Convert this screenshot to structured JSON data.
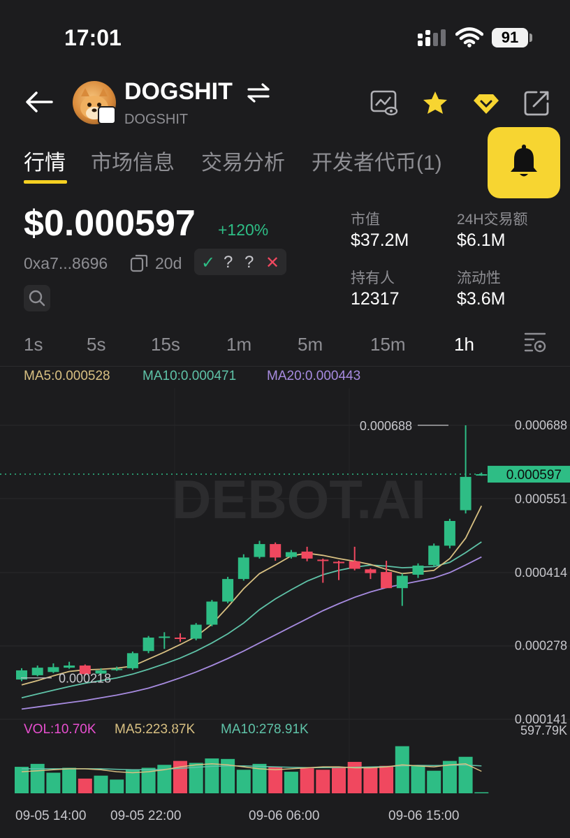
{
  "status_bar": {
    "time": "17:01",
    "battery": "91"
  },
  "header": {
    "token_name": "DOGSHIT",
    "token_symbol": "DOGSHIT",
    "icons": [
      "back-arrow-icon",
      "swap-icon",
      "watch-chart-icon",
      "star-icon",
      "diamond-icon",
      "share-icon",
      "bell-icon"
    ],
    "accent": "#f7d531"
  },
  "tabs": [
    {
      "label": "行情",
      "active": true
    },
    {
      "label": "市场信息",
      "active": false
    },
    {
      "label": "交易分析",
      "active": false
    },
    {
      "label": "开发者代币(1)",
      "active": false
    }
  ],
  "summary": {
    "price": "$0.000597",
    "change": "+120%",
    "address": "0xa7...8696",
    "age": "20d",
    "checks": [
      "✓",
      "?",
      "?",
      "✕"
    ],
    "stats": [
      {
        "label": "市值",
        "value": "$37.2M"
      },
      {
        "label": "24H交易额",
        "value": "$6.1M"
      },
      {
        "label": "持有人",
        "value": "12317"
      },
      {
        "label": "流动性",
        "value": "$3.6M"
      }
    ]
  },
  "timeframes": [
    {
      "label": "1s",
      "active": false
    },
    {
      "label": "5s",
      "active": false
    },
    {
      "label": "15s",
      "active": false
    },
    {
      "label": "1m",
      "active": false
    },
    {
      "label": "5m",
      "active": false
    },
    {
      "label": "15m",
      "active": false
    },
    {
      "label": "1h",
      "active": true
    }
  ],
  "legend": {
    "ma5": "MA5:0.000528",
    "ma10": "MA10:0.000471",
    "ma20": "MA20:0.000443",
    "vol": "VOL:10.70K",
    "vol_ma5": "MA5:223.87K",
    "vol_ma10": "MA10:278.91K"
  },
  "colors": {
    "up": "#2ebd85",
    "down": "#f0485f",
    "ma5": "#d8c082",
    "ma10": "#5fc3a8",
    "ma20": "#a78be0",
    "vol_label": "#e84fd0"
  },
  "watermark": "DEBOT.AI",
  "chart_data": {
    "type": "candlestick",
    "interval": "1h",
    "y_ticks": [
      "0.000688",
      "0.000551",
      "0.000414",
      "0.000278",
      "0.000141"
    ],
    "ylim": [
      0.000141,
      0.000688
    ],
    "current_price_label": "0.000597",
    "high_marker": "0.000688",
    "low_marker": "0.000218",
    "vol_max_label": "597.79K",
    "x_ticks": [
      "09-05 14:00",
      "09-05 22:00",
      "09-06 06:00",
      "09-06 15:00"
    ],
    "candles": [
      {
        "o": 0.000215,
        "c": 0.000232,
        "h": 0.000236,
        "l": 0.000212
      },
      {
        "o": 0.000223,
        "c": 0.000237,
        "h": 0.000241,
        "l": 0.000221
      },
      {
        "o": 0.000229,
        "c": 0.000238,
        "h": 0.000245,
        "l": 0.000227
      },
      {
        "o": 0.000237,
        "c": 0.000241,
        "h": 0.000248,
        "l": 0.000235
      },
      {
        "o": 0.000241,
        "c": 0.000225,
        "h": 0.000243,
        "l": 0.000222
      },
      {
        "o": 0.000226,
        "c": 0.000232,
        "h": 0.000236,
        "l": 0.000224
      },
      {
        "o": 0.000233,
        "c": 0.000235,
        "h": 0.000239,
        "l": 0.000231
      },
      {
        "o": 0.000236,
        "c": 0.000264,
        "h": 0.000267,
        "l": 0.000233
      },
      {
        "o": 0.000268,
        "c": 0.000293,
        "h": 0.000296,
        "l": 0.000264
      },
      {
        "o": 0.000293,
        "c": 0.000295,
        "h": 0.000303,
        "l": 0.000272
      },
      {
        "o": 0.000293,
        "c": 0.000291,
        "h": 0.000301,
        "l": 0.000285
      },
      {
        "o": 0.000291,
        "c": 0.000317,
        "h": 0.00032,
        "l": 0.000288
      },
      {
        "o": 0.000317,
        "c": 0.00036,
        "h": 0.000363,
        "l": 0.000314
      },
      {
        "o": 0.00036,
        "c": 0.000402,
        "h": 0.000406,
        "l": 0.000357
      },
      {
        "o": 0.000402,
        "c": 0.000442,
        "h": 0.000448,
        "l": 0.000399
      },
      {
        "o": 0.000443,
        "c": 0.000467,
        "h": 0.000473,
        "l": 0.00044
      },
      {
        "o": 0.000467,
        "c": 0.000442,
        "h": 0.00047,
        "l": 0.000436
      },
      {
        "o": 0.000443,
        "c": 0.000452,
        "h": 0.000456,
        "l": 0.00044
      },
      {
        "o": 0.000453,
        "c": 0.00044,
        "h": 0.000462,
        "l": 0.000435
      },
      {
        "o": 0.000438,
        "c": 0.000437,
        "h": 0.00044,
        "l": 0.000395
      },
      {
        "o": 0.000434,
        "c": 0.000433,
        "h": 0.000436,
        "l": 0.0004
      },
      {
        "o": 0.000435,
        "c": 0.000421,
        "h": 0.000462,
        "l": 0.000418
      },
      {
        "o": 0.00042,
        "c": 0.000413,
        "h": 0.000422,
        "l": 0.000402
      },
      {
        "o": 0.000415,
        "c": 0.000385,
        "h": 0.000436,
        "l": 0.000385
      },
      {
        "o": 0.000385,
        "c": 0.000408,
        "h": 0.000412,
        "l": 0.000352
      },
      {
        "o": 0.00041,
        "c": 0.000427,
        "h": 0.000431,
        "l": 0.000404
      },
      {
        "o": 0.000428,
        "c": 0.000464,
        "h": 0.000468,
        "l": 0.000425
      },
      {
        "o": 0.000464,
        "c": 0.00051,
        "h": 0.000514,
        "l": 0.000459
      },
      {
        "o": 0.00053,
        "c": 0.000592,
        "h": 0.000688,
        "l": 0.000524
      },
      {
        "o": 0.000595,
        "c": 0.000597,
        "h": 0.0006,
        "l": 0.000594
      }
    ],
    "ma5": [
      0.000205,
      0.000213,
      0.000222,
      0.00023,
      0.000233,
      0.000234,
      0.000236,
      0.00024,
      0.000253,
      0.000266,
      0.00028,
      0.000295,
      0.000318,
      0.00035,
      0.000384,
      0.000412,
      0.000428,
      0.000445,
      0.00045,
      0.000446,
      0.00044,
      0.000435,
      0.000429,
      0.00042,
      0.000412,
      0.000415,
      0.000418,
      0.00044,
      0.000478,
      0.000538
    ],
    "ma10": [
      0.000181,
      0.000188,
      0.000195,
      0.000202,
      0.000208,
      0.000213,
      0.000218,
      0.000225,
      0.000234,
      0.000244,
      0.000255,
      0.000268,
      0.000283,
      0.0003,
      0.00032,
      0.000345,
      0.000365,
      0.000382,
      0.000398,
      0.00041,
      0.000418,
      0.000424,
      0.000428,
      0.000426,
      0.000423,
      0.000424,
      0.000425,
      0.000433,
      0.000451,
      0.000471
    ],
    "ma20": [
      0.00016,
      0.000164,
      0.000168,
      0.000172,
      0.000176,
      0.000181,
      0.000186,
      0.000192,
      0.000199,
      0.000208,
      0.000218,
      0.000229,
      0.000241,
      0.000254,
      0.000268,
      0.000283,
      0.000298,
      0.000313,
      0.000328,
      0.000343,
      0.000356,
      0.000368,
      0.000378,
      0.000386,
      0.000392,
      0.000398,
      0.000404,
      0.000414,
      0.000428,
      0.000443
    ],
    "volume": [
      270,
      300,
      210,
      260,
      150,
      180,
      140,
      240,
      260,
      290,
      330,
      310,
      355,
      350,
      240,
      300,
      270,
      220,
      255,
      240,
      270,
      320,
      265,
      280,
      480,
      285,
      230,
      330,
      372,
      10.7
    ],
    "vol_ma5": [
      220,
      230,
      240,
      250,
      250,
      240,
      220,
      210,
      220,
      240,
      270,
      290,
      300,
      290,
      270,
      250,
      240,
      250,
      260,
      270,
      270,
      260,
      260,
      270,
      290,
      280,
      270,
      290,
      300,
      224
    ],
    "vol_ma10": [
      250,
      250,
      250,
      250,
      250,
      250,
      245,
      240,
      240,
      245,
      255,
      265,
      275,
      280,
      280,
      275,
      270,
      265,
      262,
      262,
      263,
      265,
      268,
      272,
      280,
      285,
      283,
      285,
      288,
      279
    ]
  }
}
